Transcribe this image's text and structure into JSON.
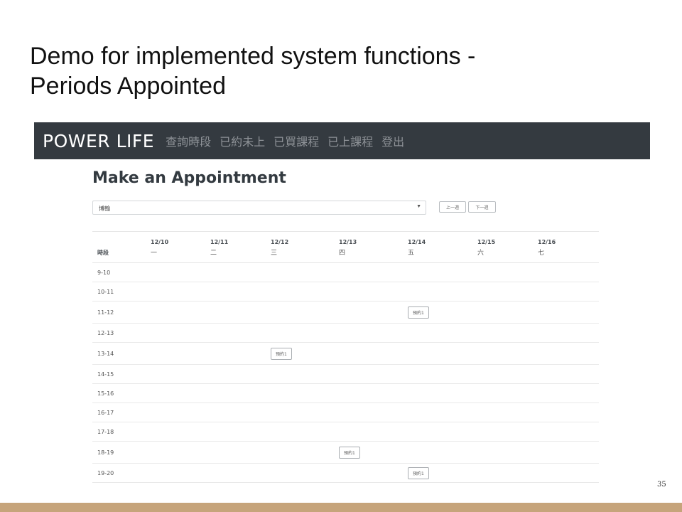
{
  "slide": {
    "title_line1": "Demo for implemented system functions -",
    "title_line2": "Periods Appointed",
    "page_number": "35",
    "footer_color": "#c6a47b"
  },
  "navbar": {
    "brand": "POWER LIFE",
    "links": [
      "查詢時段",
      "已約未上",
      "已買課程",
      "已上課程",
      "登出"
    ],
    "background": "#343a40"
  },
  "page": {
    "heading": "Make an Appointment",
    "select_value": "博翰",
    "prev_week": "上一週",
    "next_week": "下一週"
  },
  "schedule": {
    "period_header": "時段",
    "days": [
      {
        "date": "12/10",
        "weekday": "一"
      },
      {
        "date": "12/11",
        "weekday": "二"
      },
      {
        "date": "12/12",
        "weekday": "三"
      },
      {
        "date": "12/13",
        "weekday": "四"
      },
      {
        "date": "12/14",
        "weekday": "五"
      },
      {
        "date": "12/15",
        "weekday": "六"
      },
      {
        "date": "12/16",
        "weekday": "七"
      }
    ],
    "rows": [
      {
        "period": "9-10",
        "cells": [
          "",
          "",
          "",
          "",
          "",
          "",
          ""
        ]
      },
      {
        "period": "10-11",
        "cells": [
          "",
          "",
          "",
          "",
          "",
          "",
          ""
        ]
      },
      {
        "period": "11-12",
        "cells": [
          "",
          "",
          "",
          "",
          "預約1",
          "",
          ""
        ]
      },
      {
        "period": "12-13",
        "cells": [
          "",
          "",
          "",
          "",
          "",
          "",
          ""
        ]
      },
      {
        "period": "13-14",
        "cells": [
          "",
          "",
          "預約1",
          "",
          "",
          "",
          ""
        ]
      },
      {
        "period": "14-15",
        "cells": [
          "",
          "",
          "",
          "",
          "",
          "",
          ""
        ]
      },
      {
        "period": "15-16",
        "cells": [
          "",
          "",
          "",
          "",
          "",
          "",
          ""
        ]
      },
      {
        "period": "16-17",
        "cells": [
          "",
          "",
          "",
          "",
          "",
          "",
          ""
        ]
      },
      {
        "period": "17-18",
        "cells": [
          "",
          "",
          "",
          "",
          "",
          "",
          ""
        ]
      },
      {
        "period": "18-19",
        "cells": [
          "",
          "",
          "",
          "預約1",
          "",
          "",
          ""
        ]
      },
      {
        "period": "19-20",
        "cells": [
          "",
          "",
          "",
          "",
          "預約1",
          "",
          ""
        ]
      }
    ]
  }
}
